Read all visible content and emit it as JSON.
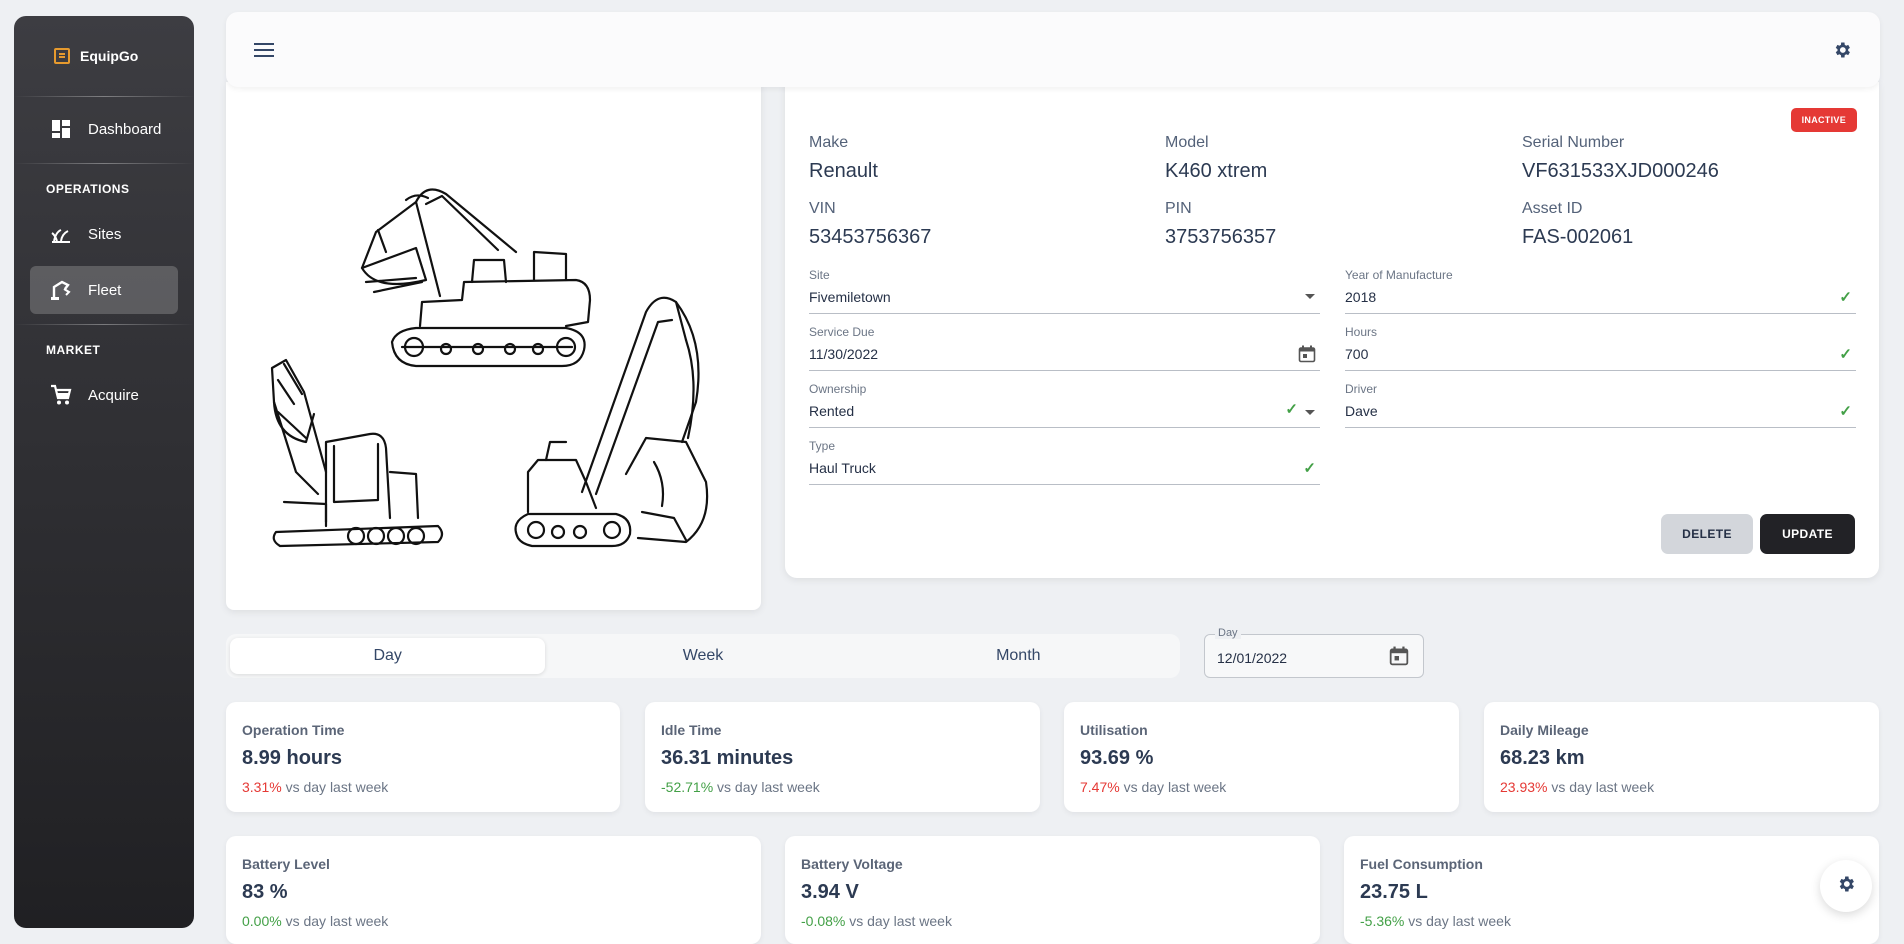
{
  "sidebar": {
    "brand": "EquipGo",
    "items": [
      {
        "label": "Dashboard",
        "icon": "dashboard-icon"
      },
      {
        "label": "Sites",
        "icon": "sites-icon"
      },
      {
        "label": "Fleet",
        "icon": "fleet-icon"
      },
      {
        "label": "Acquire",
        "icon": "cart-icon"
      }
    ],
    "sections": [
      "OPERATIONS",
      "MARKET"
    ],
    "active": "Fleet"
  },
  "asset": {
    "status_badge": "INACTIVE",
    "specs": {
      "make": {
        "label": "Make",
        "value": "Renault"
      },
      "model": {
        "label": "Model",
        "value": "K460 xtrem"
      },
      "serial": {
        "label": "Serial Number",
        "value": "VF631533XJD000246"
      },
      "vin": {
        "label": "VIN",
        "value": "53453756367"
      },
      "pin": {
        "label": "PIN",
        "value": "3753756357"
      },
      "asset_id": {
        "label": "Asset ID",
        "value": "FAS-002061"
      }
    },
    "fields": {
      "site": {
        "label": "Site",
        "value": "Fivemiletown"
      },
      "year": {
        "label": "Year of Manufacture",
        "value": "2018"
      },
      "service_due": {
        "label": "Service Due",
        "value": "11/30/2022"
      },
      "hours": {
        "label": "Hours",
        "value": "700"
      },
      "ownership": {
        "label": "Ownership",
        "value": "Rented"
      },
      "driver": {
        "label": "Driver",
        "value": "Dave"
      },
      "type": {
        "label": "Type",
        "value": "Haul Truck"
      }
    },
    "buttons": {
      "delete": "DELETE",
      "update": "UPDATE"
    }
  },
  "period": {
    "tabs": [
      "Day",
      "Week",
      "Month"
    ],
    "active": "Day",
    "date_label": "Day",
    "date_value": "12/01/2022"
  },
  "stats": [
    {
      "title": "Operation Time",
      "value": "8.99 hours",
      "change": "3.31%",
      "trend": "red",
      "suffix": "vs day last week"
    },
    {
      "title": "Idle Time",
      "value": "36.31 minutes",
      "change": "-52.71%",
      "trend": "green",
      "suffix": "vs day last week"
    },
    {
      "title": "Utilisation",
      "value": "93.69 %",
      "change": "7.47%",
      "trend": "red",
      "suffix": "vs day last week"
    },
    {
      "title": "Daily Mileage",
      "value": "68.23 km",
      "change": "23.93%",
      "trend": "red",
      "suffix": "vs day last week"
    },
    {
      "title": "Battery Level",
      "value": "83 %",
      "change": "0.00%",
      "trend": "green",
      "suffix": "vs day last week"
    },
    {
      "title": "Battery Voltage",
      "value": "3.94 V",
      "change": "-0.08%",
      "trend": "green",
      "suffix": "vs day last week"
    },
    {
      "title": "Fuel Consumption",
      "value": "23.75 L",
      "change": "-5.36%",
      "trend": "green",
      "suffix": "vs day last week"
    }
  ],
  "colors": {
    "accent": "#e69a2e",
    "danger": "#e53935",
    "success": "#43a047",
    "sidebar": "#2b2b2f"
  }
}
